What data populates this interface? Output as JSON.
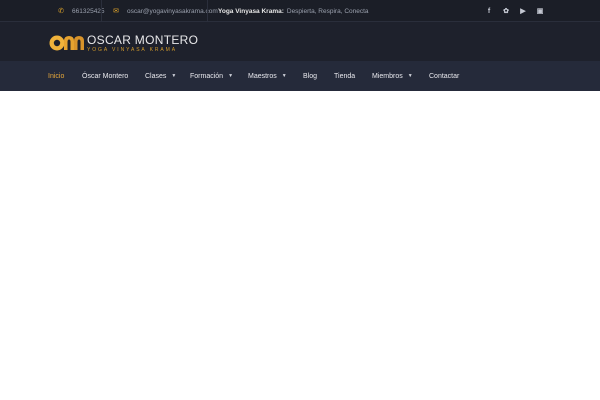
{
  "topbar": {
    "phone": "661325425",
    "email": "oscar@yogavinyasakrama.com",
    "tagline_label": "Yoga Vinyasa Krama:",
    "tagline_text": "Despierta, Respira, Conecta",
    "social_icons": [
      "facebook-icon",
      "twitter-icon",
      "youtube-icon",
      "instagram-icon"
    ]
  },
  "logo": {
    "monogram": "om",
    "name": "OSCAR MONTERO",
    "subtitle": "YOGA VINYASA KRAMA"
  },
  "nav": {
    "items": [
      {
        "label": "Inicio",
        "active": true
      },
      {
        "label": "Óscar Montero"
      },
      {
        "label": "Clases",
        "dropdown": true
      },
      {
        "label": "Formación",
        "dropdown": true
      },
      {
        "label": "Maestros",
        "dropdown": true
      },
      {
        "label": "Blog"
      },
      {
        "label": "Tienda"
      },
      {
        "label": "Miembros",
        "dropdown": true
      },
      {
        "label": "Contactar"
      }
    ]
  },
  "colors": {
    "accent": "#e8a93a",
    "topbar_bg": "#1b1e27",
    "header_bg": "#1e212c",
    "nav_bg": "#252a3a"
  }
}
